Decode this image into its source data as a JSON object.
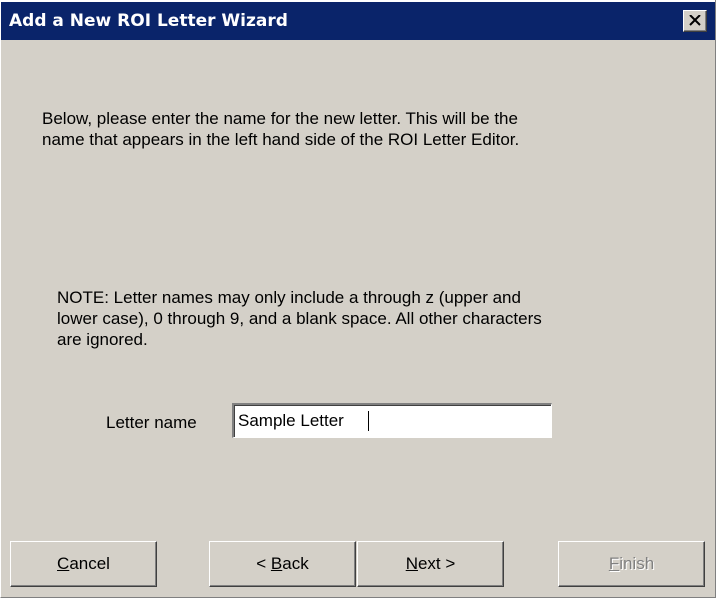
{
  "window": {
    "title": "Add a New ROI Letter Wizard",
    "close_icon": "close-icon"
  },
  "content": {
    "intro_line1": "Below, please enter the name for the new letter.  This will be the",
    "intro_line2": "name that appears in the left hand side of the ROI Letter Editor.",
    "note_line1": "NOTE: Letter names may only include a through z (upper and",
    "note_line2": "lower case), 0 through 9, and a blank space.  All other characters",
    "note_line3": "are ignored."
  },
  "form": {
    "letter_name_label": "Letter name",
    "letter_name_value": "Sample Letter"
  },
  "buttons": {
    "cancel_mnemonic": "C",
    "cancel_rest": "ancel",
    "back_prefix": "< ",
    "back_mnemonic": "B",
    "back_rest": "ack",
    "next_mnemonic": "N",
    "next_rest": "ext >",
    "finish_mnemonic": "F",
    "finish_rest": "inish",
    "finish_enabled": false
  },
  "colors": {
    "titlebar": "#0a246a",
    "window_face": "#d4d0c8",
    "disabled_text": "#808080"
  }
}
